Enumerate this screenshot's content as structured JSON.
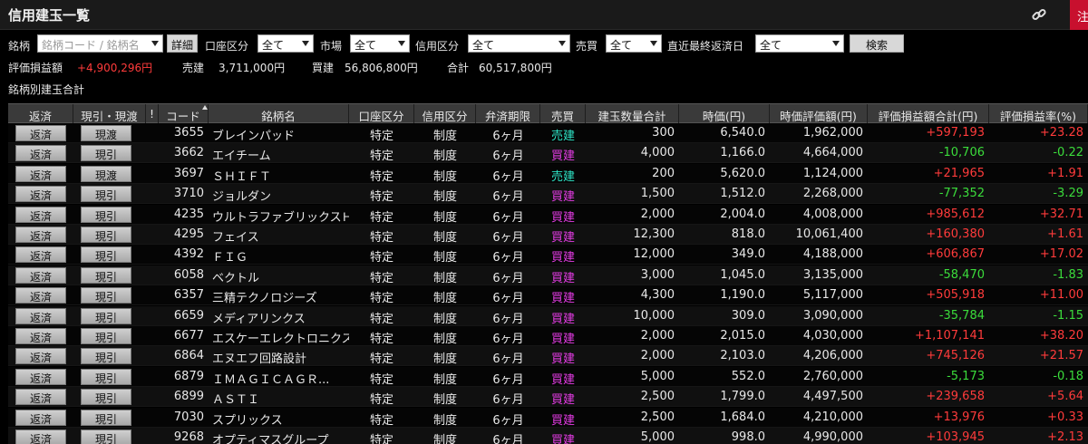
{
  "window": {
    "title": "信用建玉一覧",
    "red_button_label": "注"
  },
  "filters": {
    "brand_label": "銘柄",
    "brand_placeholder": "銘柄コード / 銘柄名",
    "detail_button": "詳細",
    "account_label": "口座区分",
    "account_value": "全て",
    "market_label": "市場",
    "market_value": "全て",
    "credit_label": "信用区分",
    "credit_value": "全て",
    "side_label": "売買",
    "side_value": "全て",
    "due_label": "直近最終返済日",
    "due_value": "全て",
    "search_button": "検索"
  },
  "summary": {
    "pl_label": "評価損益額",
    "pl_value": "+4,900,296円",
    "sell_label": "売建",
    "sell_value": "3,711,000円",
    "buy_label": "買建",
    "buy_value": "56,806,800円",
    "total_label": "合計",
    "total_value": "60,517,800円"
  },
  "section_title": "銘柄別建玉合計",
  "columns": [
    "返済",
    "現引・現渡",
    "!",
    "コード",
    "銘柄名",
    "口座区分",
    "信用区分",
    "弁済期限",
    "売買",
    "建玉数量合計",
    "時価(円)",
    "時価評価額(円)",
    "評価損益額合計(円)",
    "評価損益率(%)"
  ],
  "rows": [
    {
      "repay": "返済",
      "delivery": "現渡",
      "code": "3655",
      "name": "ブレインパッド",
      "account": "特定",
      "credit": "制度",
      "term": "6ヶ月",
      "side": "売建",
      "side_type": "sell",
      "qty": "300",
      "price": "6,540.0",
      "value": "1,962,000",
      "pl": "+597,193",
      "pl_sign": "pos",
      "rate": "+23.28"
    },
    {
      "repay": "返済",
      "delivery": "現引",
      "code": "3662",
      "name": "エイチーム",
      "account": "特定",
      "credit": "制度",
      "term": "6ヶ月",
      "side": "買建",
      "side_type": "buy",
      "qty": "4,000",
      "price": "1,166.0",
      "value": "4,664,000",
      "pl": "-10,706",
      "pl_sign": "neg",
      "rate": "-0.22"
    },
    {
      "repay": "返済",
      "delivery": "現渡",
      "code": "3697",
      "name": "ＳＨＩＦＴ",
      "account": "特定",
      "credit": "制度",
      "term": "6ヶ月",
      "side": "売建",
      "side_type": "sell",
      "qty": "200",
      "price": "5,620.0",
      "value": "1,124,000",
      "pl": "+21,965",
      "pl_sign": "pos",
      "rate": "+1.91"
    },
    {
      "repay": "返済",
      "delivery": "現引",
      "code": "3710",
      "name": "ジョルダン",
      "account": "特定",
      "credit": "制度",
      "term": "6ヶ月",
      "side": "買建",
      "side_type": "buy",
      "qty": "1,500",
      "price": "1,512.0",
      "value": "2,268,000",
      "pl": "-77,352",
      "pl_sign": "neg",
      "rate": "-3.29"
    },
    {
      "repay": "返済",
      "delivery": "現引",
      "code": "4235",
      "name": "ウルトラファブリックスＨＤ",
      "account": "特定",
      "credit": "制度",
      "term": "6ヶ月",
      "side": "買建",
      "side_type": "buy",
      "qty": "2,000",
      "price": "2,004.0",
      "value": "4,008,000",
      "pl": "+985,612",
      "pl_sign": "pos",
      "rate": "+32.71"
    },
    {
      "repay": "返済",
      "delivery": "現引",
      "code": "4295",
      "name": "フェイス",
      "account": "特定",
      "credit": "制度",
      "term": "6ヶ月",
      "side": "買建",
      "side_type": "buy",
      "qty": "12,300",
      "price": "818.0",
      "value": "10,061,400",
      "pl": "+160,380",
      "pl_sign": "pos",
      "rate": "+1.61"
    },
    {
      "repay": "返済",
      "delivery": "現引",
      "code": "4392",
      "name": "ＦＩＧ",
      "account": "特定",
      "credit": "制度",
      "term": "6ヶ月",
      "side": "買建",
      "side_type": "buy",
      "qty": "12,000",
      "price": "349.0",
      "value": "4,188,000",
      "pl": "+606,867",
      "pl_sign": "pos",
      "rate": "+17.02"
    },
    {
      "repay": "返済",
      "delivery": "現引",
      "code": "6058",
      "name": "ベクトル",
      "account": "特定",
      "credit": "制度",
      "term": "6ヶ月",
      "side": "買建",
      "side_type": "buy",
      "qty": "3,000",
      "price": "1,045.0",
      "value": "3,135,000",
      "pl": "-58,470",
      "pl_sign": "neg",
      "rate": "-1.83"
    },
    {
      "repay": "返済",
      "delivery": "現引",
      "code": "6357",
      "name": "三精テクノロジーズ",
      "account": "特定",
      "credit": "制度",
      "term": "6ヶ月",
      "side": "買建",
      "side_type": "buy",
      "qty": "4,300",
      "price": "1,190.0",
      "value": "5,117,000",
      "pl": "+505,918",
      "pl_sign": "pos",
      "rate": "+11.00"
    },
    {
      "repay": "返済",
      "delivery": "現引",
      "code": "6659",
      "name": "メディアリンクス",
      "account": "特定",
      "credit": "制度",
      "term": "6ヶ月",
      "side": "買建",
      "side_type": "buy",
      "qty": "10,000",
      "price": "309.0",
      "value": "3,090,000",
      "pl": "-35,784",
      "pl_sign": "neg",
      "rate": "-1.15"
    },
    {
      "repay": "返済",
      "delivery": "現引",
      "code": "6677",
      "name": "エスケーエレクトロニクス",
      "account": "特定",
      "credit": "制度",
      "term": "6ヶ月",
      "side": "買建",
      "side_type": "buy",
      "qty": "2,000",
      "price": "2,015.0",
      "value": "4,030,000",
      "pl": "+1,107,141",
      "pl_sign": "pos",
      "rate": "+38.20"
    },
    {
      "repay": "返済",
      "delivery": "現引",
      "code": "6864",
      "name": "エヌエフ回路設計",
      "account": "特定",
      "credit": "制度",
      "term": "6ヶ月",
      "side": "買建",
      "side_type": "buy",
      "qty": "2,000",
      "price": "2,103.0",
      "value": "4,206,000",
      "pl": "+745,126",
      "pl_sign": "pos",
      "rate": "+21.57"
    },
    {
      "repay": "返済",
      "delivery": "現引",
      "code": "6879",
      "name": "ＩＭＡＧＩＣＡＧＲ...",
      "account": "特定",
      "credit": "制度",
      "term": "6ヶ月",
      "side": "買建",
      "side_type": "buy",
      "qty": "5,000",
      "price": "552.0",
      "value": "2,760,000",
      "pl": "-5,173",
      "pl_sign": "neg",
      "rate": "-0.18"
    },
    {
      "repay": "返済",
      "delivery": "現引",
      "code": "6899",
      "name": "ＡＳＴＩ",
      "account": "特定",
      "credit": "制度",
      "term": "6ヶ月",
      "side": "買建",
      "side_type": "buy",
      "qty": "2,500",
      "price": "1,799.0",
      "value": "4,497,500",
      "pl": "+239,658",
      "pl_sign": "pos",
      "rate": "+5.64"
    },
    {
      "repay": "返済",
      "delivery": "現引",
      "code": "7030",
      "name": "スプリックス",
      "account": "特定",
      "credit": "制度",
      "term": "6ヶ月",
      "side": "買建",
      "side_type": "buy",
      "qty": "2,500",
      "price": "1,684.0",
      "value": "4,210,000",
      "pl": "+13,976",
      "pl_sign": "pos",
      "rate": "+0.33"
    },
    {
      "repay": "返済",
      "delivery": "現引",
      "code": "9268",
      "name": "オプティマスグループ",
      "account": "特定",
      "credit": "制度",
      "term": "6ヶ月",
      "side": "買建",
      "side_type": "buy",
      "qty": "5,000",
      "price": "998.0",
      "value": "4,990,000",
      "pl": "+103,945",
      "pl_sign": "pos",
      "rate": "+2.13"
    }
  ],
  "colors": {
    "positive": "#ff3b3b",
    "negative": "#3bdc3b",
    "buy": "#e63ce6",
    "sell": "#2ee6c8"
  }
}
